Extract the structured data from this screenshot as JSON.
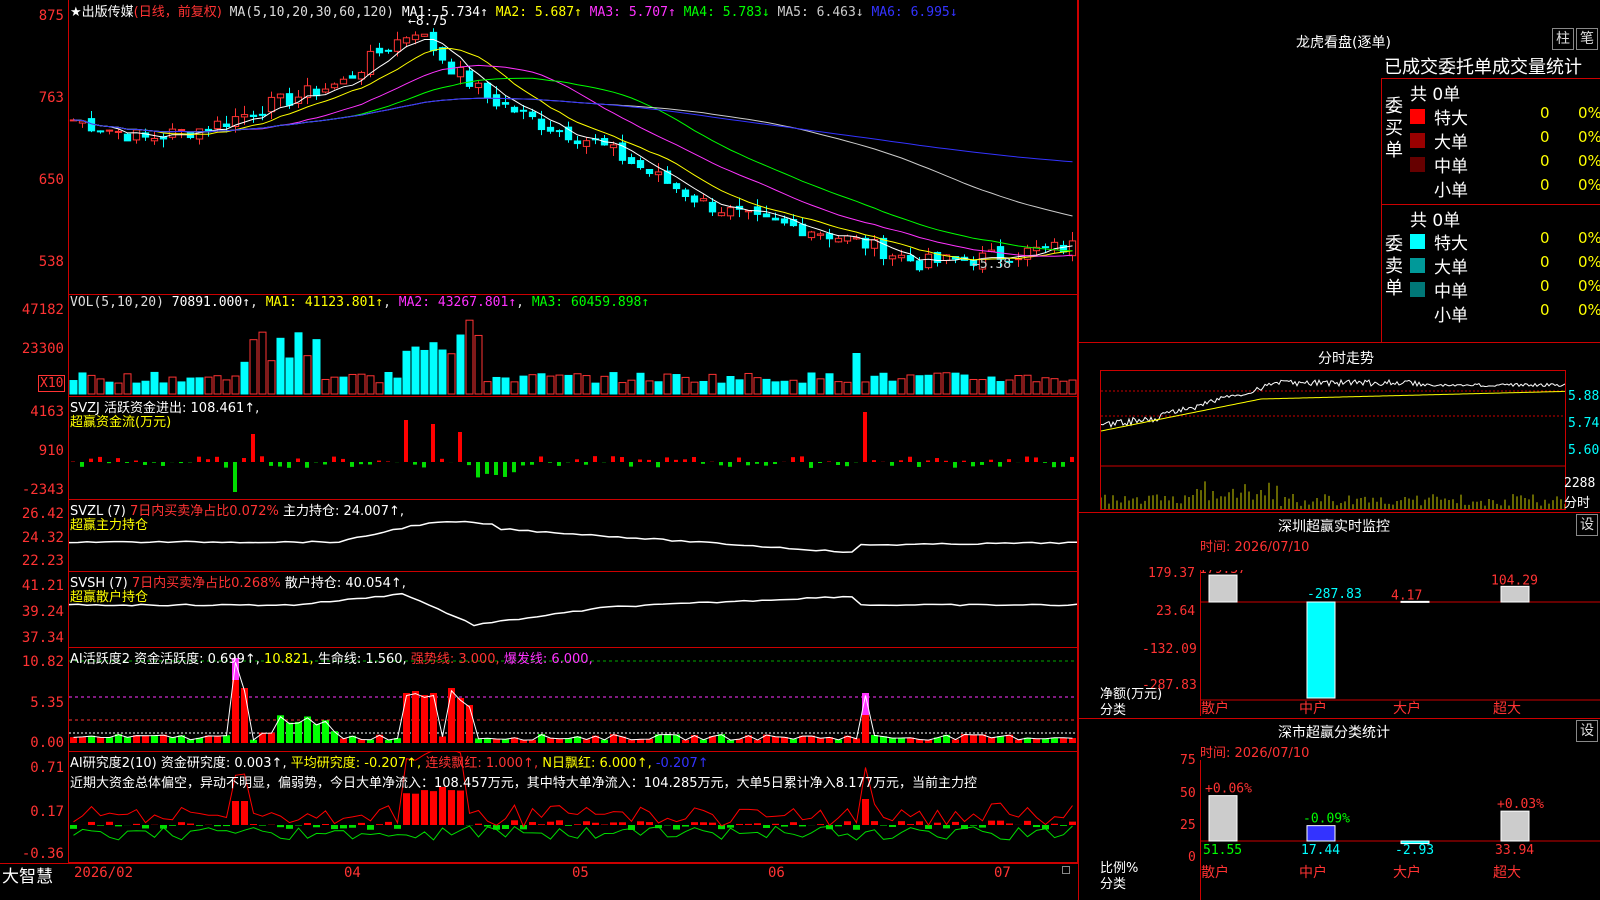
{
  "stock": {
    "name": "★出版传媒",
    "mode": "(日线，前复权)",
    "ma_label": "MA(5,10,20,30,60,120)",
    "ma": [
      {
        "label": "MA1:",
        "value": "5.734↑",
        "color": "#ffffff"
      },
      {
        "label": "MA2:",
        "value": "5.687↑",
        "color": "#ffff00"
      },
      {
        "label": "MA3:",
        "value": "5.707↑",
        "color": "#ff33ff"
      },
      {
        "label": "MA4:",
        "value": "5.783↓",
        "color": "#00ff00"
      },
      {
        "label": "MA5:",
        "value": "6.463↓",
        "color": "#cccccc"
      },
      {
        "label": "MA6:",
        "value": "6.995↓",
        "color": "#3333ff"
      }
    ],
    "high_mark": "8.75",
    "low_mark": "5.38",
    "price_axis": [
      "875",
      "763",
      "650",
      "538"
    ]
  },
  "vol": {
    "label": "VOL(5,10,20)",
    "value": "70891.000↑",
    "ma1": "MA1: 41123.801↑",
    "ma2": "MA2: 43267.801↑",
    "ma3": "MA3: 60459.898↑",
    "axis": [
      "47182",
      "23300"
    ],
    "unit": "X10"
  },
  "svzj": {
    "line1": "SVZJ  活跃资金进出: 108.461↑,",
    "line2": "超赢资金流(万元)",
    "axis": [
      "4163",
      "910",
      "-2343"
    ]
  },
  "svzl": {
    "name": "SVZL (7)",
    "ratio": "7日内买卖净占比0.072%",
    "hold": "主力持仓: 24.007↑,",
    "line2": "超赢主力持仓",
    "axis": [
      "26.42",
      "24.32",
      "22.23"
    ]
  },
  "svsh": {
    "name": "SVSH (7)",
    "ratio": "7日内买卖净占比0.268%",
    "hold": "散户持仓: 40.054↑,",
    "line2": "超赢散户持仓",
    "axis": [
      "41.21",
      "39.24",
      "37.34"
    ]
  },
  "ai1": {
    "name": "AI活跃度2",
    "v1": "资金活跃度: 0.699↑,",
    "v2": "10.821,",
    "v3": "生命线: 1.560,",
    "v4": "强势线: 3.000,",
    "v5": "爆发线: 6.000,",
    "axis": [
      "10.82",
      "5.35",
      "0.00"
    ]
  },
  "ai2": {
    "name": "AI研究度2(10)",
    "v1": "资金研究度: 0.003↑,",
    "v2": "平均研究度: -0.207↑,",
    "v3": "连续飘红: 1.000↑,",
    "v4": "N日飘红: 6.000↑,",
    "v5": "-0.207↑",
    "comment": "近期大资金总体偏空，异动不明显，偏弱势，今日大单净流入：108.457万元，其中特大单净流入：104.285万元，大单5日累计净入8.177万元，当前主力控",
    "axis": [
      "0.71",
      "0.17",
      "-0.36"
    ]
  },
  "footer": {
    "brand": "大智慧",
    "dates": [
      "2026/02",
      "04",
      "05",
      "06",
      "07"
    ]
  },
  "lhb": {
    "title": "龙虎看盘(逐单)",
    "btn1": "柱",
    "btn2": "笔",
    "subtitle": "已成交委托单成交量统计",
    "buy_total": "共 0单",
    "sell_total": "共 0单",
    "buy_side": "委买单",
    "sell_side": "委卖单",
    "rows": [
      {
        "label": "特大",
        "count": "0",
        "pct": "0%"
      },
      {
        "label": "大单",
        "count": "0",
        "pct": "0%"
      },
      {
        "label": "中单",
        "count": "0",
        "pct": "0%"
      },
      {
        "label": "小单",
        "count": "0",
        "pct": "0%"
      }
    ],
    "buy_colors": [
      "#ff0000",
      "#990000",
      "#660000",
      ""
    ],
    "sell_colors": [
      "#00ffff",
      "#009999",
      "#007777",
      ""
    ]
  },
  "intraday": {
    "title": "分时走势",
    "price_axis": [
      "5.88",
      "5.74",
      "5.60"
    ],
    "vol_axis": "2288",
    "vol_unit": "分时"
  },
  "monitor": {
    "title": "深圳超赢实时监控",
    "btn": "设",
    "date": "时间: 2026/07/10",
    "axis": [
      "179.37",
      "23.64",
      "-132.09",
      "-287.83"
    ],
    "unit": "净额(万元)",
    "cat_label": "分类",
    "bars": [
      {
        "cat": "散户",
        "value": "179.37",
        "v": 179.37
      },
      {
        "cat": "中户",
        "value": "-287.83",
        "v": -287.83
      },
      {
        "cat": "大户",
        "value": "4.17",
        "v": 4.17
      },
      {
        "cat": "超大",
        "value": "104.29",
        "v": 104.29
      }
    ]
  },
  "stats": {
    "title": "深市超赢分类统计",
    "btn": "设",
    "date": "时间: 2026/07/10",
    "axis": [
      "75",
      "50",
      "25",
      "0"
    ],
    "unit": "比例%",
    "cat_label": "分类",
    "bars": [
      {
        "cat": "散户",
        "value": "51.55",
        "change": "+0.06%",
        "v": 51.55
      },
      {
        "cat": "中户",
        "value": "17.44",
        "change": "-0.09%",
        "v": 17.44
      },
      {
        "cat": "大户",
        "value": "-2.93",
        "change": "",
        "v": -2.93
      },
      {
        "cat": "超大",
        "value": "33.94",
        "change": "+0.03%",
        "v": 33.94
      }
    ]
  }
}
